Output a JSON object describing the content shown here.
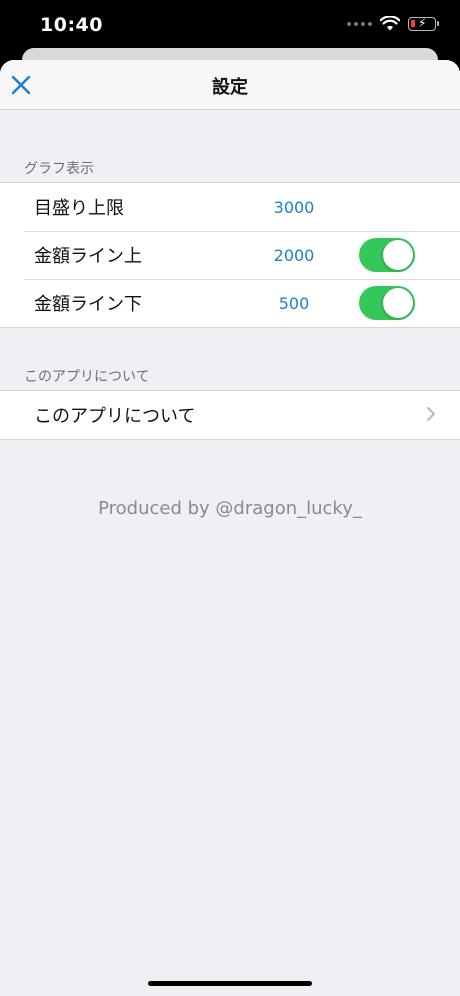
{
  "status_bar": {
    "time": "10:40"
  },
  "nav": {
    "title": "設定",
    "close_icon": "close-x-icon"
  },
  "sections": [
    {
      "header": "グラフ表示",
      "rows": [
        {
          "label": "目盛り上限",
          "value": "3000",
          "toggle": null
        },
        {
          "label": "金額ライン上",
          "value": "2000",
          "toggle": true
        },
        {
          "label": "金額ライン下",
          "value": "500",
          "toggle": true
        }
      ]
    },
    {
      "header": "このアプリについて",
      "rows": [
        {
          "label": "このアプリについて",
          "chevron_icon": "chevron-right-icon"
        }
      ]
    }
  ],
  "footer": {
    "credit": "Produced by @dragon_lucky_"
  },
  "colors": {
    "accent_blue": "#1b7fd1",
    "toggle_on": "#34c759",
    "background": "#efeff4"
  }
}
